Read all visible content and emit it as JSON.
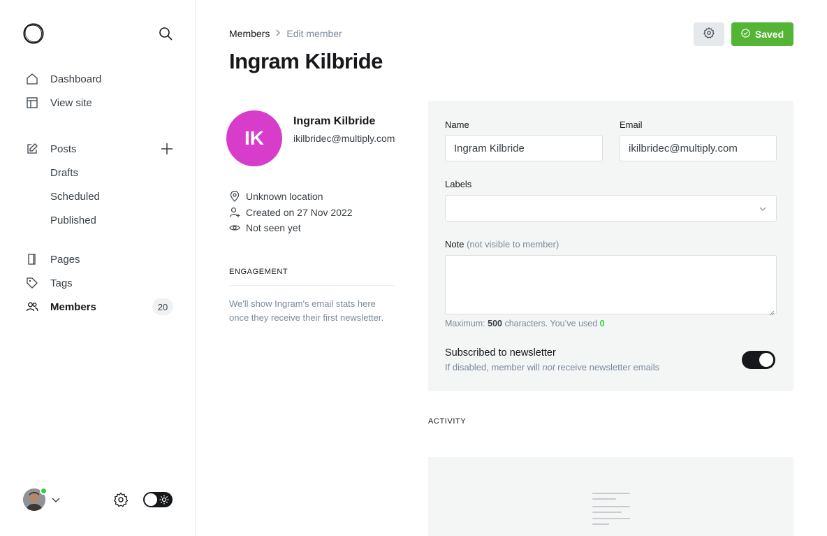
{
  "sidebar": {
    "nav": [
      {
        "label": "Dashboard",
        "icon": "home-icon"
      },
      {
        "label": "View site",
        "icon": "layout-icon"
      }
    ],
    "posts": {
      "label": "Posts",
      "icon": "edit-icon",
      "sub": [
        "Drafts",
        "Scheduled",
        "Published"
      ]
    },
    "secondary": [
      {
        "label": "Pages",
        "icon": "pages-icon"
      },
      {
        "label": "Tags",
        "icon": "tag-icon"
      },
      {
        "label": "Members",
        "icon": "members-icon",
        "count": "20",
        "active": true
      }
    ]
  },
  "breadcrumb": {
    "parent": "Members",
    "current": "Edit member"
  },
  "page_title": "Ingram Kilbride",
  "actions": {
    "saved_label": "Saved"
  },
  "member": {
    "initials": "IK",
    "name": "Ingram Kilbride",
    "email": "ikilbridec@multiply.com",
    "avatar_color": "#d73cca",
    "meta": {
      "location": "Unknown location",
      "created": "Created on 27 Nov 2022",
      "seen": "Not seen yet"
    }
  },
  "engagement": {
    "heading": "ENGAGEMENT",
    "text": "We'll show Ingram's email stats here once they receive their first newsletter."
  },
  "form": {
    "name_label": "Name",
    "name_value": "Ingram Kilbride",
    "email_label": "Email",
    "email_value": "ikilbridec@multiply.com",
    "labels_label": "Labels",
    "note_label": "Note",
    "note_hint": "(not visible to member)",
    "note_max_prefix": "Maximum: ",
    "note_max": "500",
    "note_max_mid": " characters. You’ve used ",
    "note_used": "0",
    "newsletter_title": "Subscribed to newsletter",
    "newsletter_desc_pre": "If disabled, member will ",
    "newsletter_desc_em": "not",
    "newsletter_desc_post": " receive newsletter emails",
    "newsletter_enabled": true
  },
  "activity": {
    "heading": "ACTIVITY"
  },
  "colors": {
    "accent_green": "#53b435",
    "text": "#15171a",
    "muted": "#7c8b9a"
  }
}
